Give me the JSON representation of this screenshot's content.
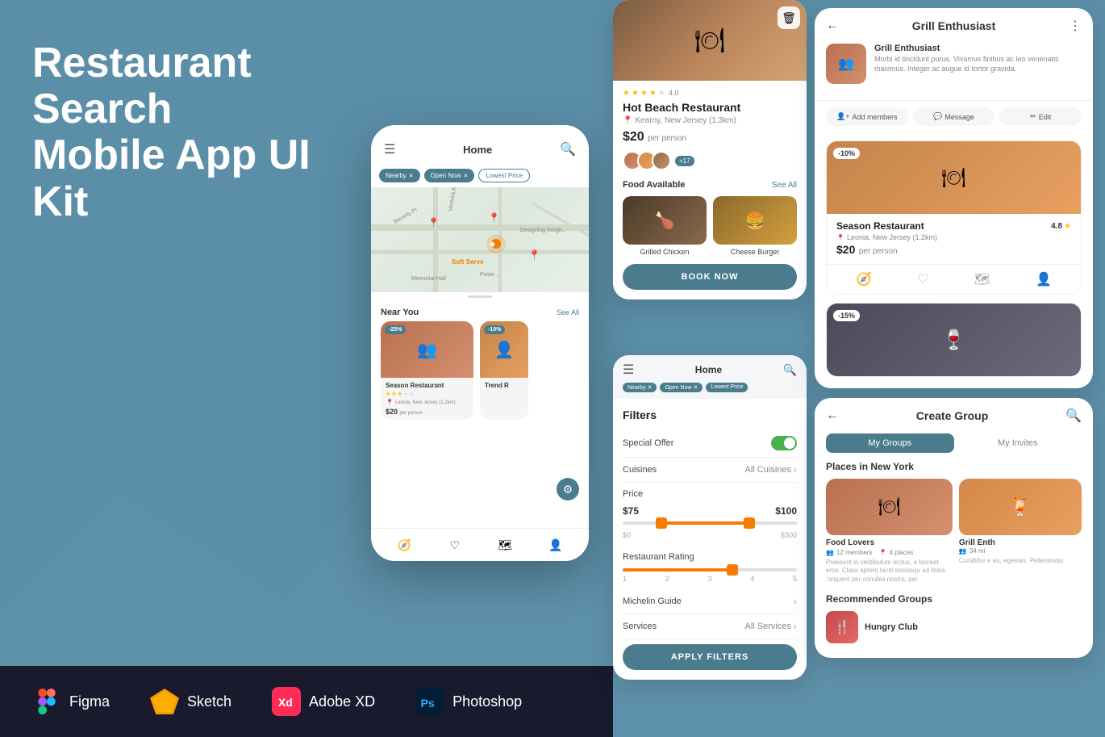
{
  "title": "Restaurant Search Mobile App UI Kit",
  "subtitle": "Restaurant Search\nMobile App UI Kit",
  "tools": [
    {
      "name": "Figma",
      "icon": "figma",
      "color": "#F24E1E"
    },
    {
      "name": "Sketch",
      "icon": "sketch",
      "color": "#F7B500"
    },
    {
      "name": "Adobe XD",
      "icon": "xd",
      "color": "#FF2D55"
    },
    {
      "name": "Photoshop",
      "icon": "ps",
      "color": "#001d34"
    }
  ],
  "phone": {
    "title": "Home",
    "filter_tags": [
      "Nearby",
      "Open Now",
      "Lowest Price"
    ],
    "section_nearby": "Near You",
    "see_all": "See All",
    "nearby_cards": [
      {
        "name": "Season Restaurant",
        "location": "Leonia, New Jersey (1.2km)",
        "price": "$20",
        "per_person": "per person",
        "discount": "-25%",
        "stars": 3.5
      },
      {
        "name": "Trend R",
        "discount": "-10%"
      }
    ]
  },
  "detail_panel": {
    "restaurant_name": "Hot Beach Restaurant",
    "location": "Kearny, New Jersey (1.3km)",
    "price": "$20",
    "per_person": "per person",
    "stars": 4,
    "plus_count": "+17",
    "food_available": "Food Available",
    "see_all": "See All",
    "foods": [
      {
        "name": "Grilled Chicken"
      },
      {
        "name": "Cheese Burger"
      }
    ],
    "book_btn": "BOOK NOW"
  },
  "filters_panel": {
    "title": "Filters",
    "special_offer": "Special Offer",
    "cuisines": "Cuisines",
    "cuisines_value": "All Cuisines",
    "price_label": "Price",
    "price_min": "$75",
    "price_max": "$100",
    "range_min": "$0",
    "range_max": "$300",
    "restaurant_rating": "Restaurant Rating",
    "rating_nums": [
      "1",
      "2",
      "3",
      "4",
      "5"
    ],
    "michelin": "Michelin Guide",
    "services": "Services",
    "services_value": "All Services",
    "apply_btn": "APPLY FILTERS"
  },
  "grill_panel": {
    "title": "Grill Enthusiast",
    "items": [
      {
        "name": "Grill Enthusiast",
        "desc": "Morbi id tincidunt purus. Vivamus finibus ac leo venenatis maximus. Integer ac augue id tortor gravida."
      }
    ],
    "actions": [
      "Add members",
      "Message",
      "Edit"
    ],
    "restaurant_cards": [
      {
        "name": "Season Restaurant",
        "rating": "4.8",
        "location": "Leonia, New Jersey (1.2km)",
        "price": "$20",
        "per_person": "per person",
        "discount": "-10%"
      }
    ]
  },
  "create_group_panel": {
    "title": "Create Group",
    "tabs": [
      "My Groups",
      "My Invites"
    ],
    "places_title": "Places in New York",
    "places": [
      {
        "name": "Food Lovers",
        "members": "12 members",
        "places_count": "4 places",
        "desc": "Praesent in vestibulum lectus, a laoreet eros. Class aptent taciti sociosqu ad litora torquent per conubia nostra, per."
      },
      {
        "name": "Grill Enth",
        "members": "34 mi",
        "desc": "Curabitur e eu, egestas. Pellentesqu"
      }
    ],
    "recommended_title": "Recommended Groups",
    "recommended": [
      {
        "name": "Hungry Club"
      }
    ]
  }
}
